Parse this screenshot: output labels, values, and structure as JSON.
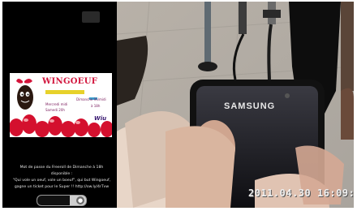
{
  "ad": {
    "title": "WINGOEUF",
    "line_1": "Dimanche 9h/midi",
    "line_2": "Mercredi midi",
    "line_3": "à 18h",
    "line_4": "Samedi 20h",
    "logo": "Wiu"
  },
  "message": {
    "line_1": "Mot de passe du Freeroll de Dimanche à 18h",
    "line_2": "disponible :",
    "line_3": "\"Qui vole un oeuf, vole un boeuf\", qui but Wingoeuf,",
    "line_4": "gagne un ticket pour le Super !! http://ow.ly/4rTvw"
  },
  "unlock_slider": {
    "progress": 0.67,
    "icon": "lock-icon"
  },
  "photo": {
    "brand": "SAMSUNG",
    "timestamp": "2011.04.30 16:09:17"
  }
}
